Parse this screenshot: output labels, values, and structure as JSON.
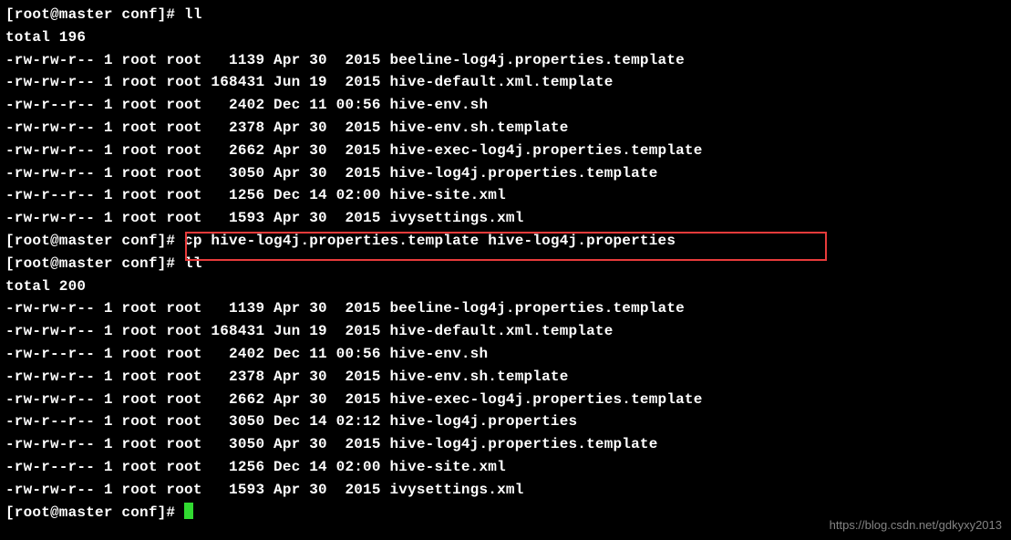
{
  "prompt": {
    "user": "root",
    "host": "master",
    "dir": "conf",
    "symbol": "#"
  },
  "commands": {
    "cmd1": "ll",
    "cmd2": "cp hive-log4j.properties.template hive-log4j.properties",
    "cmd3": "ll",
    "cmd4": ""
  },
  "totals": {
    "total1": "total 196",
    "total2": "total 200"
  },
  "list1": [
    {
      "perm": "-rw-rw-r--",
      "links": "1",
      "owner": "root",
      "group": "root",
      "size": "  1139",
      "date": "Apr 30  2015",
      "name": "beeline-log4j.properties.template"
    },
    {
      "perm": "-rw-rw-r--",
      "links": "1",
      "owner": "root",
      "group": "root",
      "size": "168431",
      "date": "Jun 19  2015",
      "name": "hive-default.xml.template"
    },
    {
      "perm": "-rw-r--r--",
      "links": "1",
      "owner": "root",
      "group": "root",
      "size": "  2402",
      "date": "Dec 11 00:56",
      "name": "hive-env.sh"
    },
    {
      "perm": "-rw-rw-r--",
      "links": "1",
      "owner": "root",
      "group": "root",
      "size": "  2378",
      "date": "Apr 30  2015",
      "name": "hive-env.sh.template"
    },
    {
      "perm": "-rw-rw-r--",
      "links": "1",
      "owner": "root",
      "group": "root",
      "size": "  2662",
      "date": "Apr 30  2015",
      "name": "hive-exec-log4j.properties.template"
    },
    {
      "perm": "-rw-rw-r--",
      "links": "1",
      "owner": "root",
      "group": "root",
      "size": "  3050",
      "date": "Apr 30  2015",
      "name": "hive-log4j.properties.template"
    },
    {
      "perm": "-rw-r--r--",
      "links": "1",
      "owner": "root",
      "group": "root",
      "size": "  1256",
      "date": "Dec 14 02:00",
      "name": "hive-site.xml"
    },
    {
      "perm": "-rw-rw-r--",
      "links": "1",
      "owner": "root",
      "group": "root",
      "size": "  1593",
      "date": "Apr 30  2015",
      "name": "ivysettings.xml"
    }
  ],
  "list2": [
    {
      "perm": "-rw-rw-r--",
      "links": "1",
      "owner": "root",
      "group": "root",
      "size": "  1139",
      "date": "Apr 30  2015",
      "name": "beeline-log4j.properties.template"
    },
    {
      "perm": "-rw-rw-r--",
      "links": "1",
      "owner": "root",
      "group": "root",
      "size": "168431",
      "date": "Jun 19  2015",
      "name": "hive-default.xml.template"
    },
    {
      "perm": "-rw-r--r--",
      "links": "1",
      "owner": "root",
      "group": "root",
      "size": "  2402",
      "date": "Dec 11 00:56",
      "name": "hive-env.sh"
    },
    {
      "perm": "-rw-rw-r--",
      "links": "1",
      "owner": "root",
      "group": "root",
      "size": "  2378",
      "date": "Apr 30  2015",
      "name": "hive-env.sh.template"
    },
    {
      "perm": "-rw-rw-r--",
      "links": "1",
      "owner": "root",
      "group": "root",
      "size": "  2662",
      "date": "Apr 30  2015",
      "name": "hive-exec-log4j.properties.template"
    },
    {
      "perm": "-rw-r--r--",
      "links": "1",
      "owner": "root",
      "group": "root",
      "size": "  3050",
      "date": "Dec 14 02:12",
      "name": "hive-log4j.properties"
    },
    {
      "perm": "-rw-rw-r--",
      "links": "1",
      "owner": "root",
      "group": "root",
      "size": "  3050",
      "date": "Apr 30  2015",
      "name": "hive-log4j.properties.template"
    },
    {
      "perm": "-rw-r--r--",
      "links": "1",
      "owner": "root",
      "group": "root",
      "size": "  1256",
      "date": "Dec 14 02:00",
      "name": "hive-site.xml"
    },
    {
      "perm": "-rw-rw-r--",
      "links": "1",
      "owner": "root",
      "group": "root",
      "size": "  1593",
      "date": "Apr 30  2015",
      "name": "ivysettings.xml"
    }
  ],
  "watermark": "https://blog.csdn.net/gdkyxy2013",
  "colors": {
    "highlight": "#e83b3b",
    "cursor": "#31da31"
  }
}
